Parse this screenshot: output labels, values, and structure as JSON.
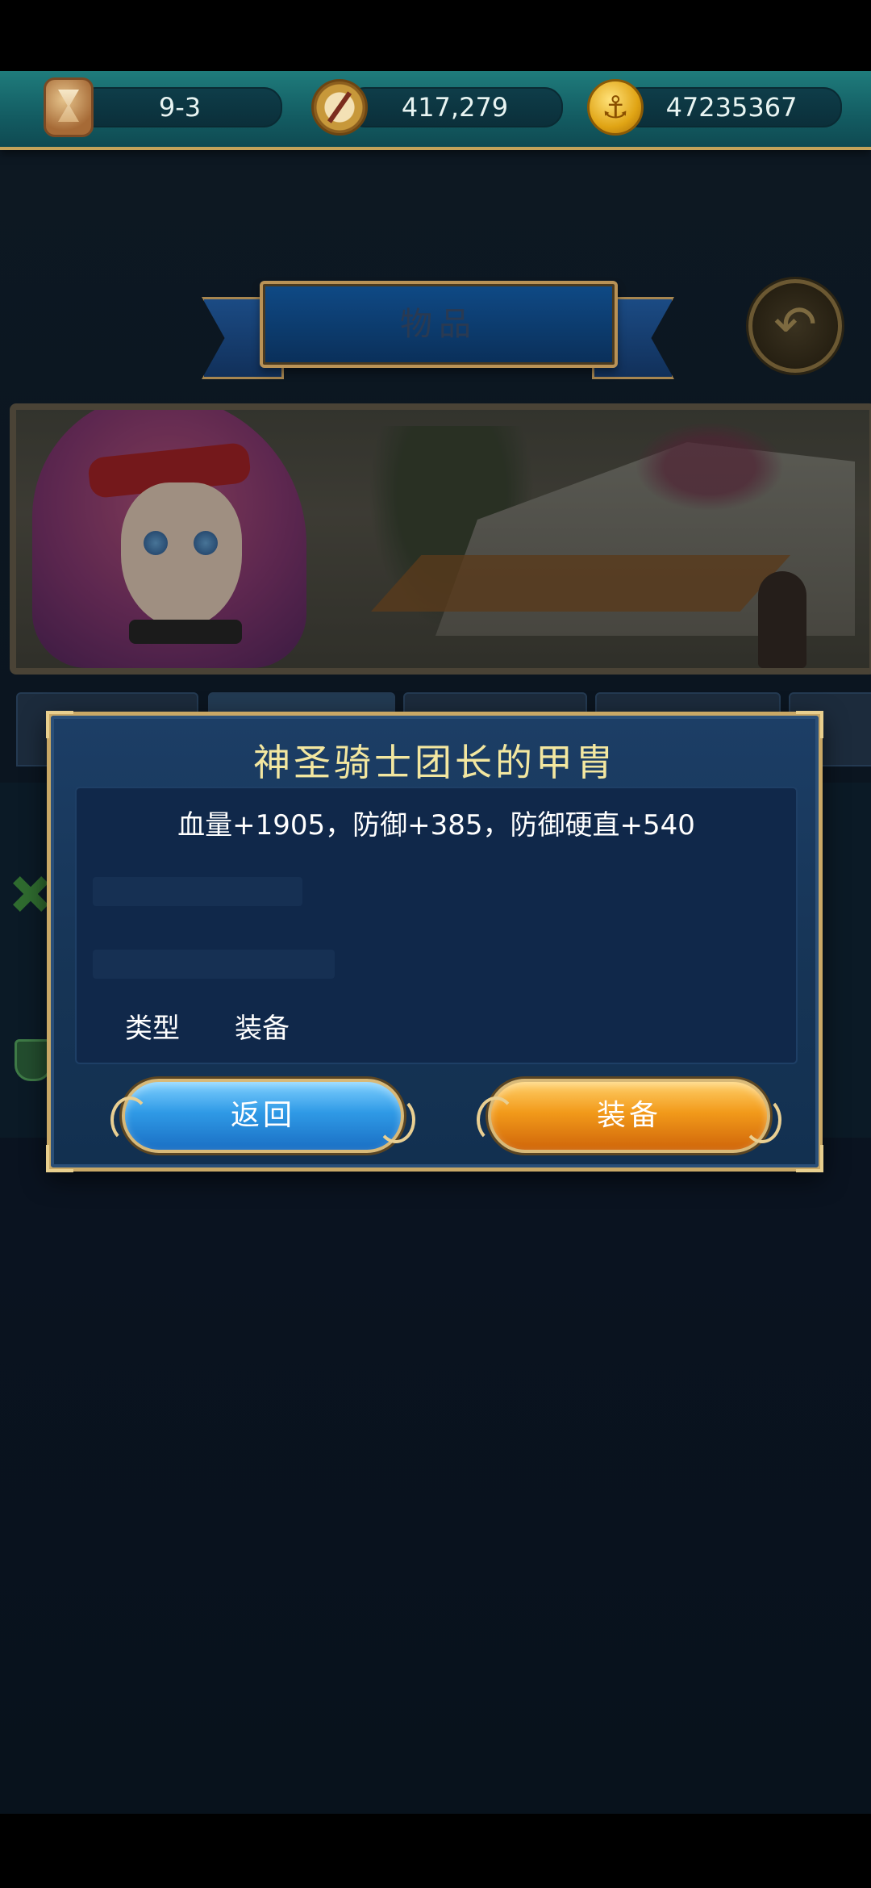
{
  "resources": {
    "stage": "9-3",
    "compass_value": "417,279",
    "gold": "47235367",
    "icons": [
      "hourglass-icon",
      "compass-icon",
      "anchor-coin-icon"
    ]
  },
  "screen_title": "物品",
  "dialog": {
    "item_name": "神圣骑士团长的甲胄",
    "stats": "血量+1905，防御+385，防御硬直+540",
    "type_label": "类型",
    "type_value": "装备",
    "buttons": {
      "back": "返回",
      "equip": "装备"
    }
  },
  "colors": {
    "title_gold": "#f3e7a0",
    "back_button": "#2f9ae6",
    "equip_button": "#f29a1a",
    "frame_gold": "#c9a866"
  }
}
